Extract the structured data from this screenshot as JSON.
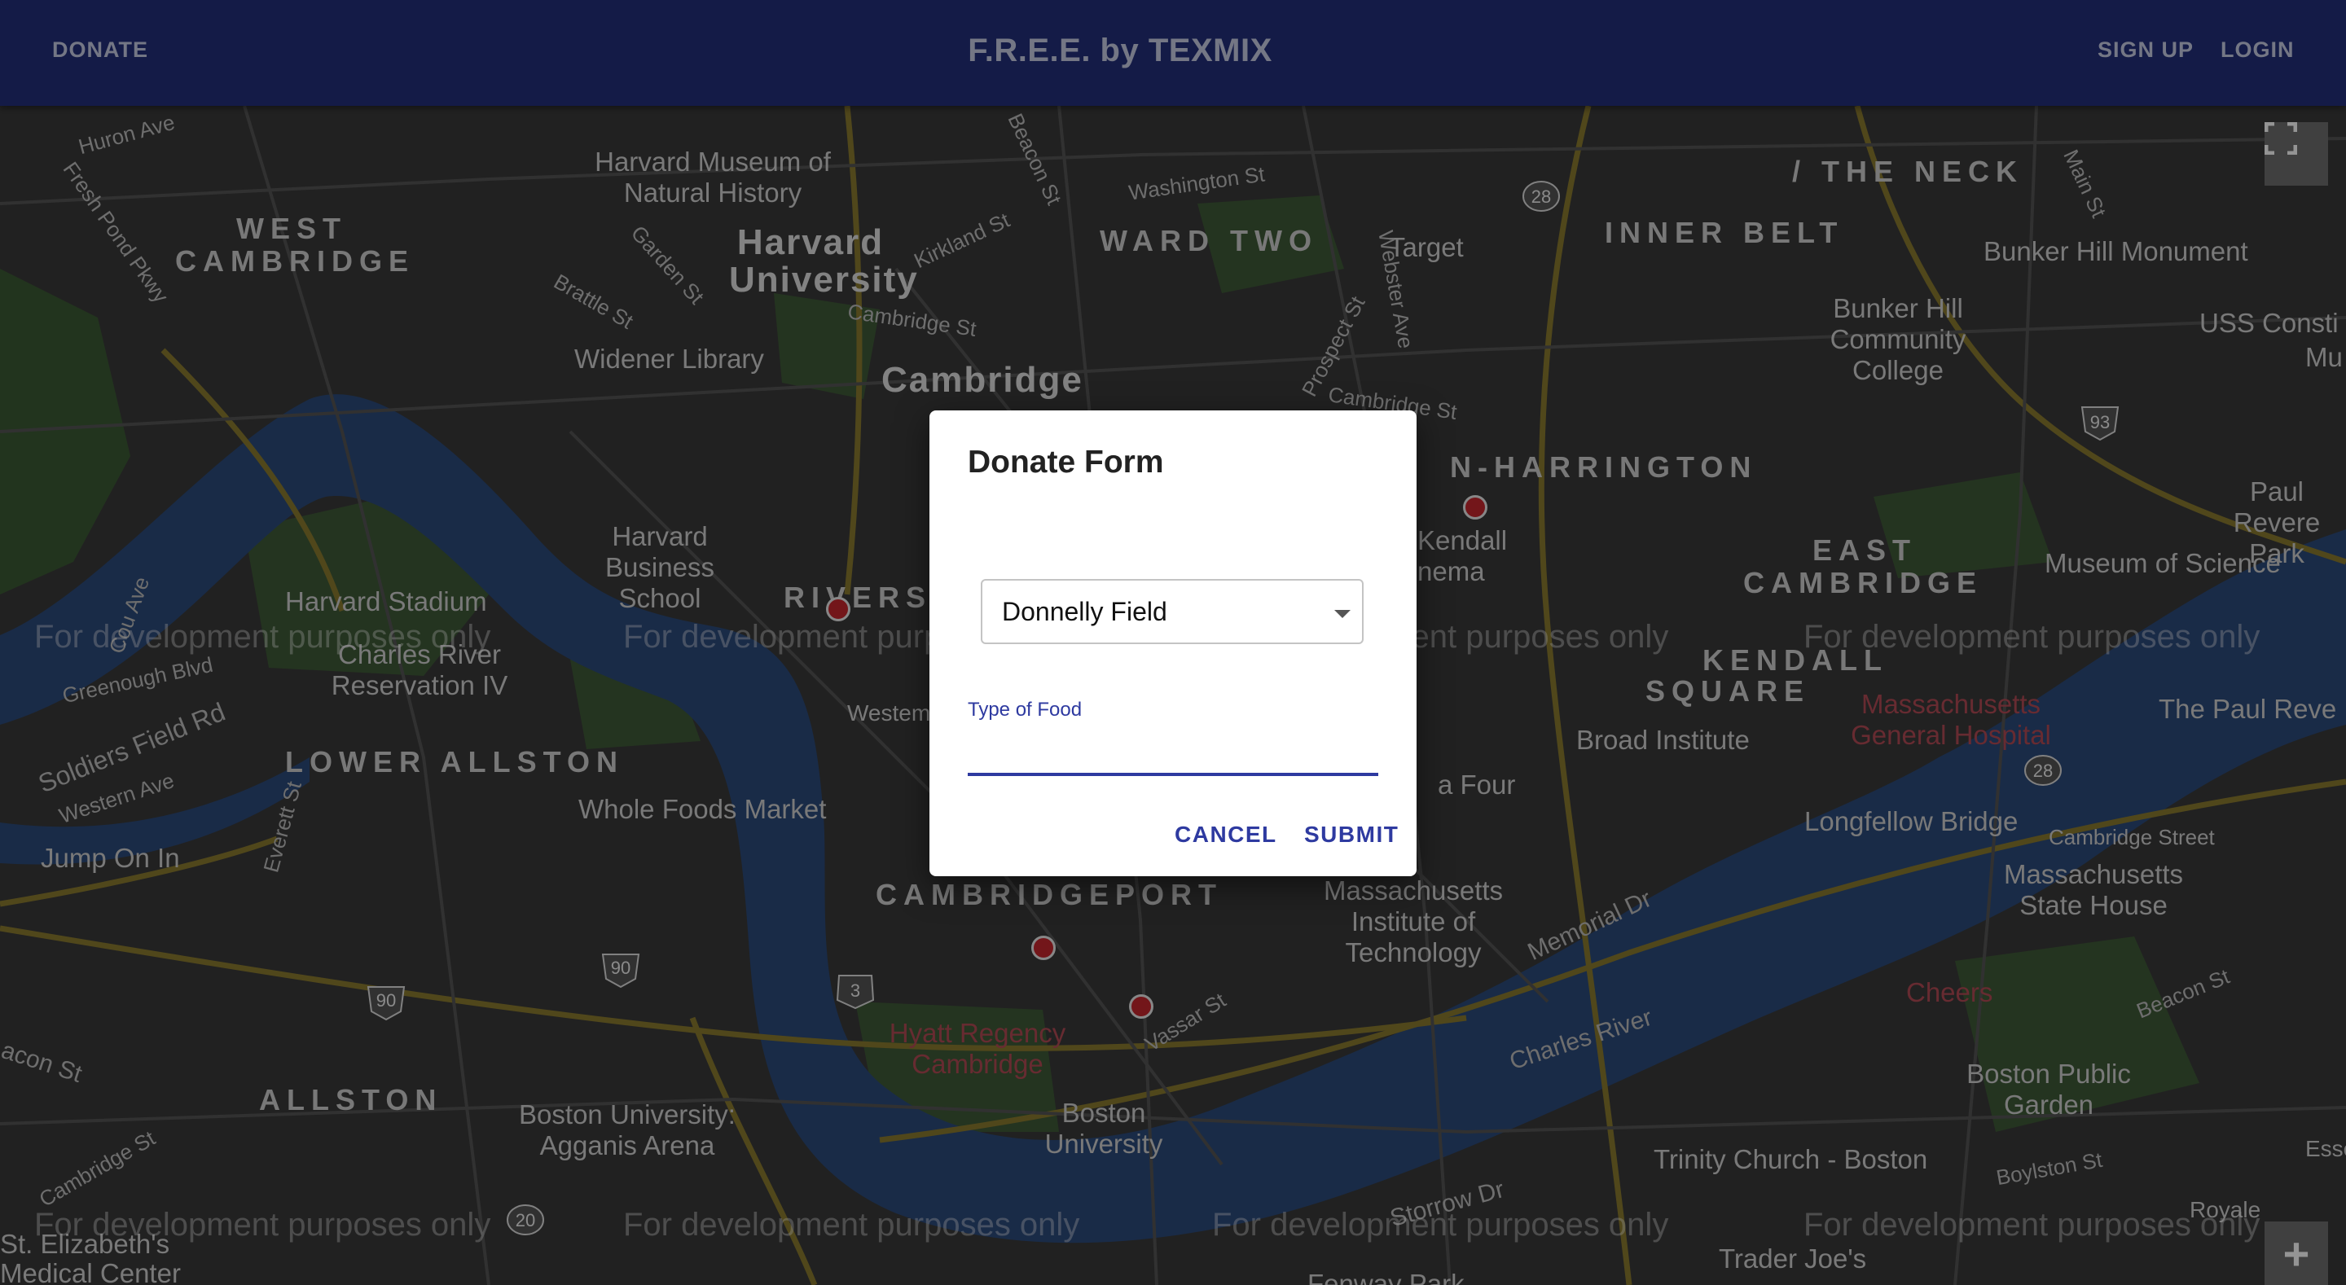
{
  "appbar": {
    "donate": "DONATE",
    "title": "F.R.E.E. by TEXMIX",
    "signup": "SIGN UP",
    "login": "LOGIN"
  },
  "map": {
    "districts": [
      "WEST CAMBRIDGE",
      "WARD TWO",
      "INNER BELT",
      "LOWER ALLSTON",
      "CAMBRIDGEPORT",
      "ALLSTON",
      "EAST CAMBRIDGE",
      "KENDALL SQUARE",
      "RIVERS",
      "N-HARRINGTON",
      "/ THE NECK"
    ],
    "cities": [
      "Cambridge",
      "Harvard University"
    ],
    "pois": [
      "Harvard Museum of Natural History",
      "Target",
      "Bunker Hill Monument",
      "Bunker Hill Community College",
      "USS Consti",
      "Mu",
      "Widener Library",
      "Harvard Business School",
      "Harvard Stadium",
      "Charles River Reservation IV",
      "Paul Revere Park",
      "Museum of Science",
      "Kendall",
      "nema",
      "Broad Institute",
      "Massachusetts General Hospital",
      "The Paul Reve",
      "Whole Foods Market",
      "Jump On In",
      "Massachusetts Institute of Technology",
      "Longfellow Bridge",
      "Massachusetts State House",
      "Cambridge Street",
      "Cheers",
      "Hyatt Regency Cambridge",
      "Boston University",
      "Boston University: Agganis Arena",
      "Boston Public Garden",
      "Trinity Church - Boston",
      "Charles River",
      "Trader Joe's",
      "Fenway Park",
      "St. Elizabeth's Medical Center",
      "Royale",
      "Esse",
      "a Four",
      "Westem"
    ],
    "roads": [
      "Huron Ave",
      "Fresh Pond Pkwy",
      "Beacon St",
      "Washington St",
      "Kirkland St",
      "Brattle St",
      "Garden St",
      "Cambridge St",
      "Webster Ave",
      "Prospect St",
      "Cambridge St",
      "Main St",
      "Greenough Blvd",
      "Soldiers Field Rd",
      "Western Ave",
      "Everett St",
      "Memorial Dr",
      "Vassar St",
      "Storrow Dr",
      "Boylston St",
      "Beacon St",
      "Cambridge St",
      "Cou Ave",
      "acon St"
    ],
    "route_shields": [
      "28",
      "93",
      "28",
      "90",
      "90",
      "3",
      "20"
    ],
    "watermark": "For development purposes only",
    "fullscreen_icon": "fullscreen-icon",
    "zoom_in": "+"
  },
  "dialog": {
    "title": "Donate Form",
    "location_select": "Donnelly Field",
    "food_label": "Type of Food",
    "food_value": "",
    "cancel": "CANCEL",
    "submit": "SUBMIT"
  }
}
